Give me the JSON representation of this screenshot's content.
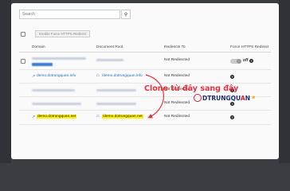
{
  "search": {
    "placeholder": "Search",
    "button_icon": "search-icon"
  },
  "toolbar": {
    "enable_button": "Enable Force HTTPS Redirect"
  },
  "table": {
    "headers": [
      "Domain",
      "Document Root",
      "Redirects To",
      "Force HTTPS Redirect"
    ],
    "row_demo_info": {
      "domain": "demo.dotrungquan.info",
      "docroot": "/demo.dotrungquan.info",
      "redirects": "Not Redirected"
    },
    "row_demo_net": {
      "domain": "demo.dotrungquan.net",
      "docroot": "/demo.dotrungquan.net",
      "redirects": "Not Redirected"
    },
    "blurred_redirects": [
      "Not Redirected",
      "Not Redirected",
      "Not Redirected"
    ],
    "toggle_off_label": "off"
  },
  "annotation": "Clone từ đây sang đây",
  "logo": {
    "prefix": "D",
    "name_dark": "TRUNGQU",
    "name_red": "A",
    "name_tail": "N"
  },
  "colors": {
    "link": "#2a6fb6",
    "annotation": "#e8333d",
    "highlight": "#fff100"
  }
}
